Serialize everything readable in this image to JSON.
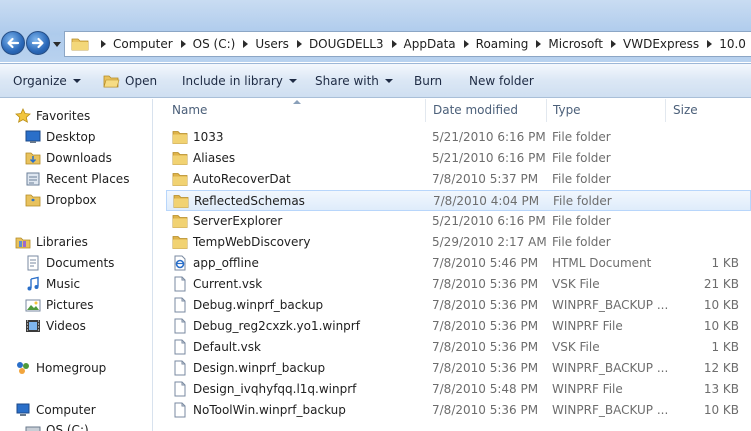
{
  "address": {
    "crumbs": [
      "Computer",
      "OS (C:)",
      "Users",
      "DOUGDELL3",
      "AppData",
      "Roaming",
      "Microsoft",
      "VWDExpress",
      "10.0"
    ]
  },
  "toolbar": {
    "organize": "Organize",
    "open": "Open",
    "include": "Include in library",
    "share": "Share with",
    "burn": "Burn",
    "new_folder": "New folder"
  },
  "nav": {
    "favorites": "Favorites",
    "desktop": "Desktop",
    "downloads": "Downloads",
    "recent": "Recent Places",
    "dropbox": "Dropbox",
    "libraries": "Libraries",
    "documents": "Documents",
    "music": "Music",
    "pictures": "Pictures",
    "videos": "Videos",
    "homegroup": "Homegroup",
    "computer": "Computer",
    "osdrive": "OS (C:)"
  },
  "columns": {
    "name": "Name",
    "date": "Date modified",
    "type": "Type",
    "size": "Size"
  },
  "files": [
    {
      "name": "1033",
      "date": "5/21/2010 6:16 PM",
      "type": "File folder",
      "size": "",
      "icon": "folder-icon"
    },
    {
      "name": "Aliases",
      "date": "5/21/2010 6:16 PM",
      "type": "File folder",
      "size": "",
      "icon": "folder-icon"
    },
    {
      "name": "AutoRecoverDat",
      "date": "7/8/2010 5:37 PM",
      "type": "File folder",
      "size": "",
      "icon": "folder-icon"
    },
    {
      "name": "ReflectedSchemas",
      "date": "7/8/2010 4:04 PM",
      "type": "File folder",
      "size": "",
      "icon": "folder-icon",
      "selected": true
    },
    {
      "name": "ServerExplorer",
      "date": "5/21/2010 6:16 PM",
      "type": "File folder",
      "size": "",
      "icon": "folder-icon"
    },
    {
      "name": "TempWebDiscovery",
      "date": "5/29/2010 2:17 AM",
      "type": "File folder",
      "size": "",
      "icon": "folder-icon"
    },
    {
      "name": "app_offline",
      "date": "7/8/2010 5:46 PM",
      "type": "HTML Document",
      "size": "1 KB",
      "icon": "ie-document-icon"
    },
    {
      "name": "Current.vsk",
      "date": "7/8/2010 5:36 PM",
      "type": "VSK File",
      "size": "21 KB",
      "icon": "file-icon"
    },
    {
      "name": "Debug.winprf_backup",
      "date": "7/8/2010 5:36 PM",
      "type": "WINPRF_BACKUP ...",
      "size": "10 KB",
      "icon": "file-icon"
    },
    {
      "name": "Debug_reg2cxzk.yo1.winprf",
      "date": "7/8/2010 5:36 PM",
      "type": "WINPRF File",
      "size": "10 KB",
      "icon": "file-icon"
    },
    {
      "name": "Default.vsk",
      "date": "7/8/2010 5:36 PM",
      "type": "VSK File",
      "size": "1 KB",
      "icon": "file-icon"
    },
    {
      "name": "Design.winprf_backup",
      "date": "7/8/2010 5:36 PM",
      "type": "WINPRF_BACKUP ...",
      "size": "12 KB",
      "icon": "file-icon"
    },
    {
      "name": "Design_ivqhyfqq.l1q.winprf",
      "date": "7/8/2010 5:48 PM",
      "type": "WINPRF File",
      "size": "13 KB",
      "icon": "file-icon"
    },
    {
      "name": "NoToolWin.winprf_backup",
      "date": "7/8/2010 5:36 PM",
      "type": "WINPRF_BACKUP ...",
      "size": "10 KB",
      "icon": "file-icon"
    }
  ]
}
